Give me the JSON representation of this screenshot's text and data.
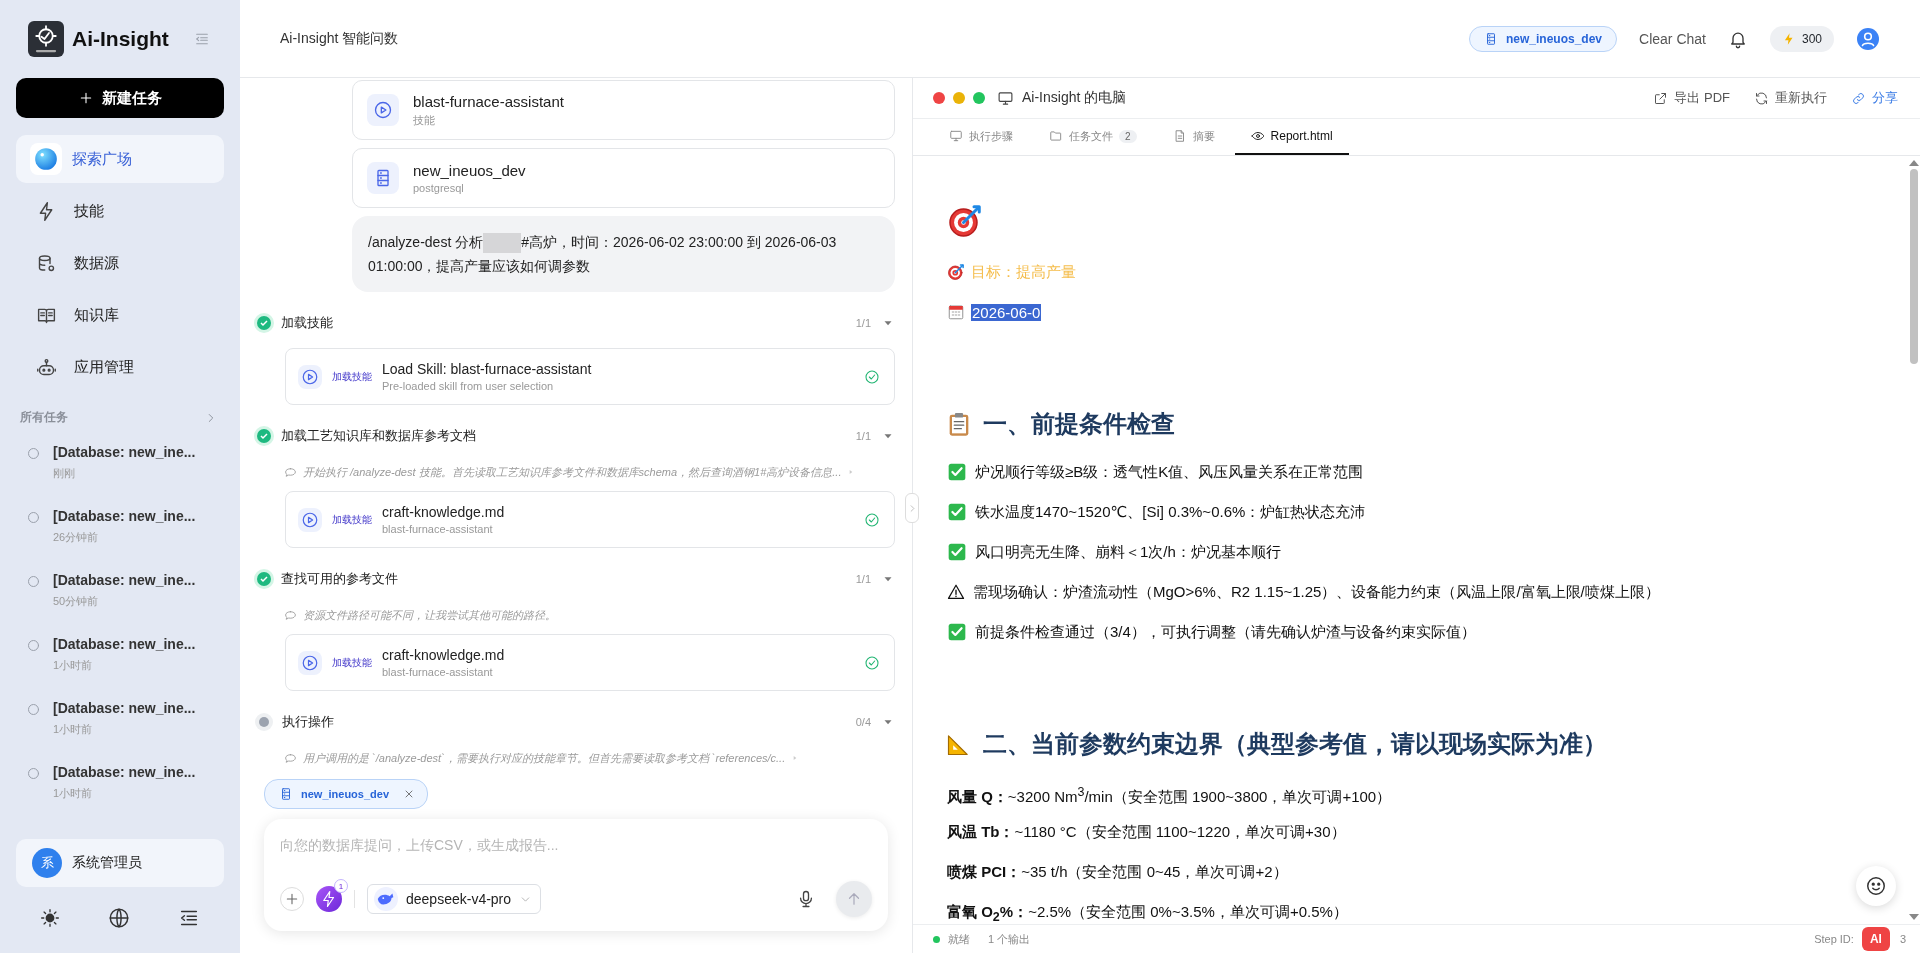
{
  "sidebar": {
    "logo_text": "Ai-Insight",
    "new_task": "新建任务",
    "nav": [
      {
        "kind": "explore",
        "label": "探索广场",
        "selected": true
      },
      {
        "kind": "skill",
        "label": "技能",
        "selected": false
      },
      {
        "kind": "datasource",
        "label": "数据源",
        "selected": false
      },
      {
        "kind": "knowledge",
        "label": "知识库",
        "selected": false
      },
      {
        "kind": "apps",
        "label": "应用管理",
        "selected": false
      }
    ],
    "section_title": "所有任务",
    "tasks": [
      {
        "title": "[Database: new_ine...",
        "time": "刚刚"
      },
      {
        "title": "[Database: new_ine...",
        "time": "26分钟前"
      },
      {
        "title": "[Database: new_ine...",
        "time": "50分钟前"
      },
      {
        "title": "[Database: new_ine...",
        "time": "1小时前"
      },
      {
        "title": "[Database: new_ine...",
        "time": "1小时前"
      },
      {
        "title": "[Database: new_ine...",
        "time": "1小时前"
      }
    ],
    "user": {
      "avatar": "系",
      "name": "系统管理员"
    }
  },
  "header": {
    "title": "Ai-Insight 智能问数",
    "datasource": "new_ineuos_dev",
    "clear_chat": "Clear Chat",
    "credits": "300"
  },
  "chat": {
    "attachments": [
      {
        "kind": "skill",
        "title": "blast-furnace-assistant",
        "subtitle": "技能"
      },
      {
        "kind": "database",
        "title": "new_ineuos_dev",
        "subtitle": "postgresql"
      }
    ],
    "user_message": {
      "before": "/analyze-dest 分析",
      "redacted": true,
      "after": "#高炉，时间：2026-06-02 23:00:00 到 2026-06-03 01:00:00，提高产量应该如何调参数"
    },
    "steps": [
      {
        "title": "加载技能",
        "done": true,
        "count": "1/1",
        "items": [
          {
            "kind": "tool",
            "tag": "加载技能",
            "title": "Load Skill: blast-furnace-assistant",
            "subtitle": "Pre-loaded skill from user selection",
            "done": true
          }
        ]
      },
      {
        "title": "加载工艺知识库和数据库参考文档",
        "done": true,
        "count": "1/1",
        "items": [
          {
            "kind": "note",
            "text": "开始执行 /analyze-dest 技能。首先读取工艺知识库参考文件和数据库schema，然后查询酒钢1#高炉设备信息...",
            "expandable": true
          },
          {
            "kind": "tool",
            "tag": "加载技能",
            "title": "craft-knowledge.md",
            "subtitle": "blast-furnace-assistant",
            "done": true
          }
        ]
      },
      {
        "title": "查找可用的参考文件",
        "done": true,
        "count": "1/1",
        "items": [
          {
            "kind": "note",
            "text": "资源文件路径可能不同，让我尝试其他可能的路径。",
            "expandable": false
          },
          {
            "kind": "tool",
            "tag": "加载技能",
            "title": "craft-knowledge.md",
            "subtitle": "blast-furnace-assistant",
            "done": true
          }
        ]
      },
      {
        "title": "执行操作",
        "done": false,
        "count": "0/4",
        "items": [
          {
            "kind": "note",
            "text": "用户调用的是 `/analyze-dest`，需要执行对应的技能章节。但首先需要读取参考文档 `references/c...",
            "expandable": true
          }
        ]
      }
    ],
    "context_chip": "new_ineuos_dev",
    "input": {
      "placeholder": "向您的数据库提问，上传CSV，或生成报告...",
      "skill_count": "1",
      "model": "deepseek-v4-pro"
    }
  },
  "report": {
    "title": "Ai-Insight 的电脑",
    "actions": [
      {
        "kind": "export",
        "label": "导出 PDF"
      },
      {
        "kind": "rerun",
        "label": "重新执行"
      },
      {
        "kind": "share",
        "label": "分享"
      }
    ],
    "tabs": [
      {
        "kind": "steps",
        "label": "执行步骤",
        "selected": false
      },
      {
        "kind": "files",
        "label": "任务文件",
        "count": "2",
        "selected": false
      },
      {
        "kind": "summary",
        "label": "摘要",
        "selected": false
      },
      {
        "kind": "preview",
        "label": "Report.html",
        "selected": true
      }
    ],
    "blocks": [
      {
        "kind": "hero"
      },
      {
        "kind": "goal",
        "text": "目标：提高产量"
      },
      {
        "kind": "date",
        "text": "2026-06-0",
        "selected": true
      },
      {
        "kind": "heading",
        "text": "一、前提条件检查"
      },
      {
        "kind": "check",
        "passed": true,
        "text": "炉况顺行等级≥B级：透气性K值、风压风量关系在正常范围"
      },
      {
        "kind": "check",
        "passed": true,
        "text": "铁水温度1470~1520℃、[Si] 0.3%~0.6%：炉缸热状态充沛"
      },
      {
        "kind": "check",
        "passed": true,
        "text": "风口明亮无生降、崩料＜1次/h：炉况基本顺行"
      },
      {
        "kind": "check",
        "passed": false,
        "text": "需现场确认：炉渣流动性（MgO>6%、R2 1.15~1.25）、设备能力约束（风温上限/富氧上限/喷煤上限）"
      },
      {
        "kind": "check",
        "passed": true,
        "text": "前提条件检查通过（3/4），可执行调整（请先确认炉渣与设备约束实际值）"
      },
      {
        "kind": "heading",
        "text": "二、当前参数约束边界（典型参考值，请以现场实际为准）"
      },
      {
        "kind": "param",
        "text": "**风量 Q：**~3200 Nm$^{3}$/min（安全范围 1900~3800，单次可调+100）"
      },
      {
        "kind": "param",
        "text": "**风温 Tb：**~1180 °C（安全范围 1100~1220，单次可调+30）"
      },
      {
        "kind": "param",
        "text": "**喷煤 PCI：**~35 t/h（安全范围 0~45，单次可调+2）"
      },
      {
        "kind": "param",
        "text": "**富氧 O$_{2}$%：**~2.5%（安全范围 0%~3.5%，单次可调+0.5%）"
      }
    ],
    "status": {
      "state": "就绪",
      "outputs": "1 个输出",
      "step_label": "Step ID:",
      "step_tail": "3"
    },
    "badge": "AI"
  }
}
